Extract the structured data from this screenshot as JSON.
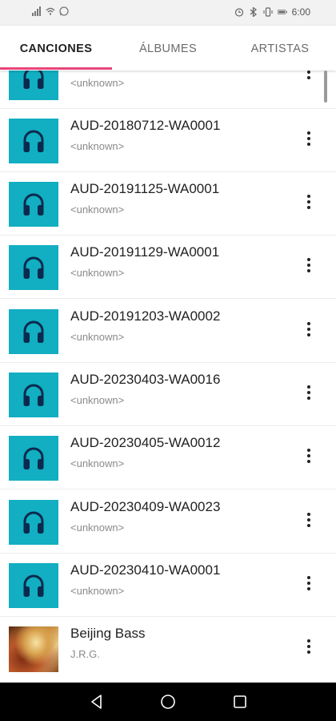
{
  "status_bar": {
    "left_icons": [
      "signal-icon",
      "wifi-icon",
      "whatsapp-icon"
    ],
    "right_icons": [
      "alarm-icon",
      "bluetooth-icon",
      "vibrate-icon",
      "battery-icon"
    ],
    "time": "6:00"
  },
  "tabs": [
    {
      "label": "CANCIONES",
      "active": true
    },
    {
      "label": "ÁLBUMES",
      "active": false
    },
    {
      "label": "ARTISTAS",
      "active": false
    }
  ],
  "accent_color": "#e8457a",
  "thumb_color": "#12aec2",
  "songs": [
    {
      "title": "",
      "artist": "<unknown>",
      "art": "headphones-icon"
    },
    {
      "title": "AUD-20180712-WA0001",
      "artist": "<unknown>",
      "art": "headphones-icon"
    },
    {
      "title": "AUD-20191125-WA0001",
      "artist": "<unknown>",
      "art": "headphones-icon"
    },
    {
      "title": "AUD-20191129-WA0001",
      "artist": "<unknown>",
      "art": "headphones-icon"
    },
    {
      "title": "AUD-20191203-WA0002",
      "artist": "<unknown>",
      "art": "headphones-icon"
    },
    {
      "title": "AUD-20230403-WA0016",
      "artist": "<unknown>",
      "art": "headphones-icon"
    },
    {
      "title": "AUD-20230405-WA0012",
      "artist": "<unknown>",
      "art": "headphones-icon"
    },
    {
      "title": "AUD-20230409-WA0023",
      "artist": "<unknown>",
      "art": "headphones-icon"
    },
    {
      "title": "AUD-20230410-WA0001",
      "artist": "<unknown>",
      "art": "headphones-icon"
    },
    {
      "title": "Beijing Bass",
      "artist": "J.R.G.",
      "art": "album-cover"
    }
  ],
  "nav_bar": [
    "back-icon",
    "home-icon",
    "recents-icon"
  ]
}
